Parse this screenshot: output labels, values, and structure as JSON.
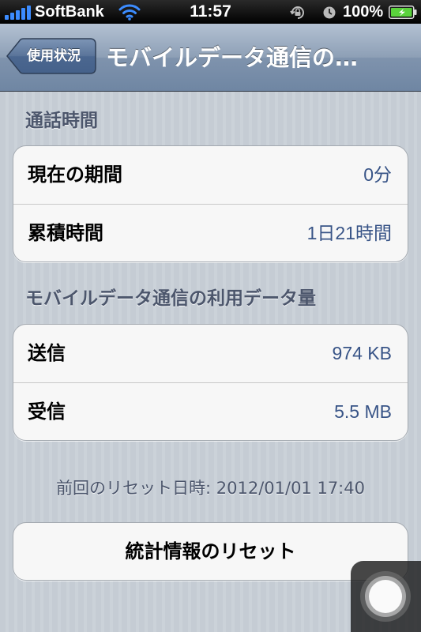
{
  "status_bar": {
    "carrier": "SoftBank",
    "time": "11:57",
    "battery_percent": "100%",
    "icons": [
      "signal-icon",
      "wifi-icon",
      "rotation-lock-icon",
      "alarm-icon",
      "battery-charging-icon"
    ],
    "signal_color": "#3c8cff",
    "battery_color": "#5ad23c"
  },
  "nav": {
    "back_label": "使用状況",
    "title": "モバイルデータ通信の…"
  },
  "call_time": {
    "header": "通話時間",
    "rows": [
      {
        "label": "現在の期間",
        "value": "0分"
      },
      {
        "label": "累積時間",
        "value": "1日21時間"
      }
    ]
  },
  "data_usage": {
    "header": "モバイルデータ通信の利用データ量",
    "rows": [
      {
        "label": "送信",
        "value": "974 KB"
      },
      {
        "label": "受信",
        "value": "5.5 MB"
      }
    ]
  },
  "footer": {
    "last_reset": "前回のリセット日時: 2012/01/01 17:40"
  },
  "actions": {
    "reset_label": "統計情報のリセット"
  },
  "colors": {
    "value_blue": "#385487",
    "header_gray": "#4c566c",
    "nav_bar": "#7f93ad"
  }
}
